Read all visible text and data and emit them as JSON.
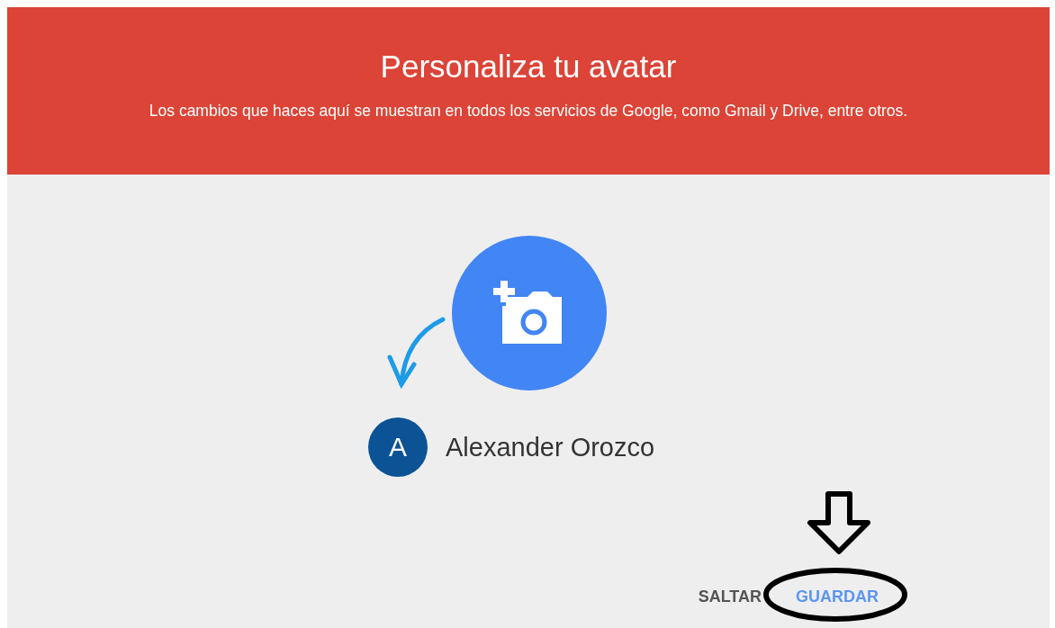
{
  "header": {
    "title": "Personaliza tu avatar",
    "subtitle": "Los cambios que haces aquí se muestran en todos los servicios de Google, como Gmail y Drive, entre otros."
  },
  "profile": {
    "initial": "A",
    "name": "Alexander Orozco"
  },
  "buttons": [
    {
      "label": "SALTAR",
      "kind": "plain"
    },
    {
      "label": "GUARDAR",
      "kind": "primary"
    }
  ]
}
